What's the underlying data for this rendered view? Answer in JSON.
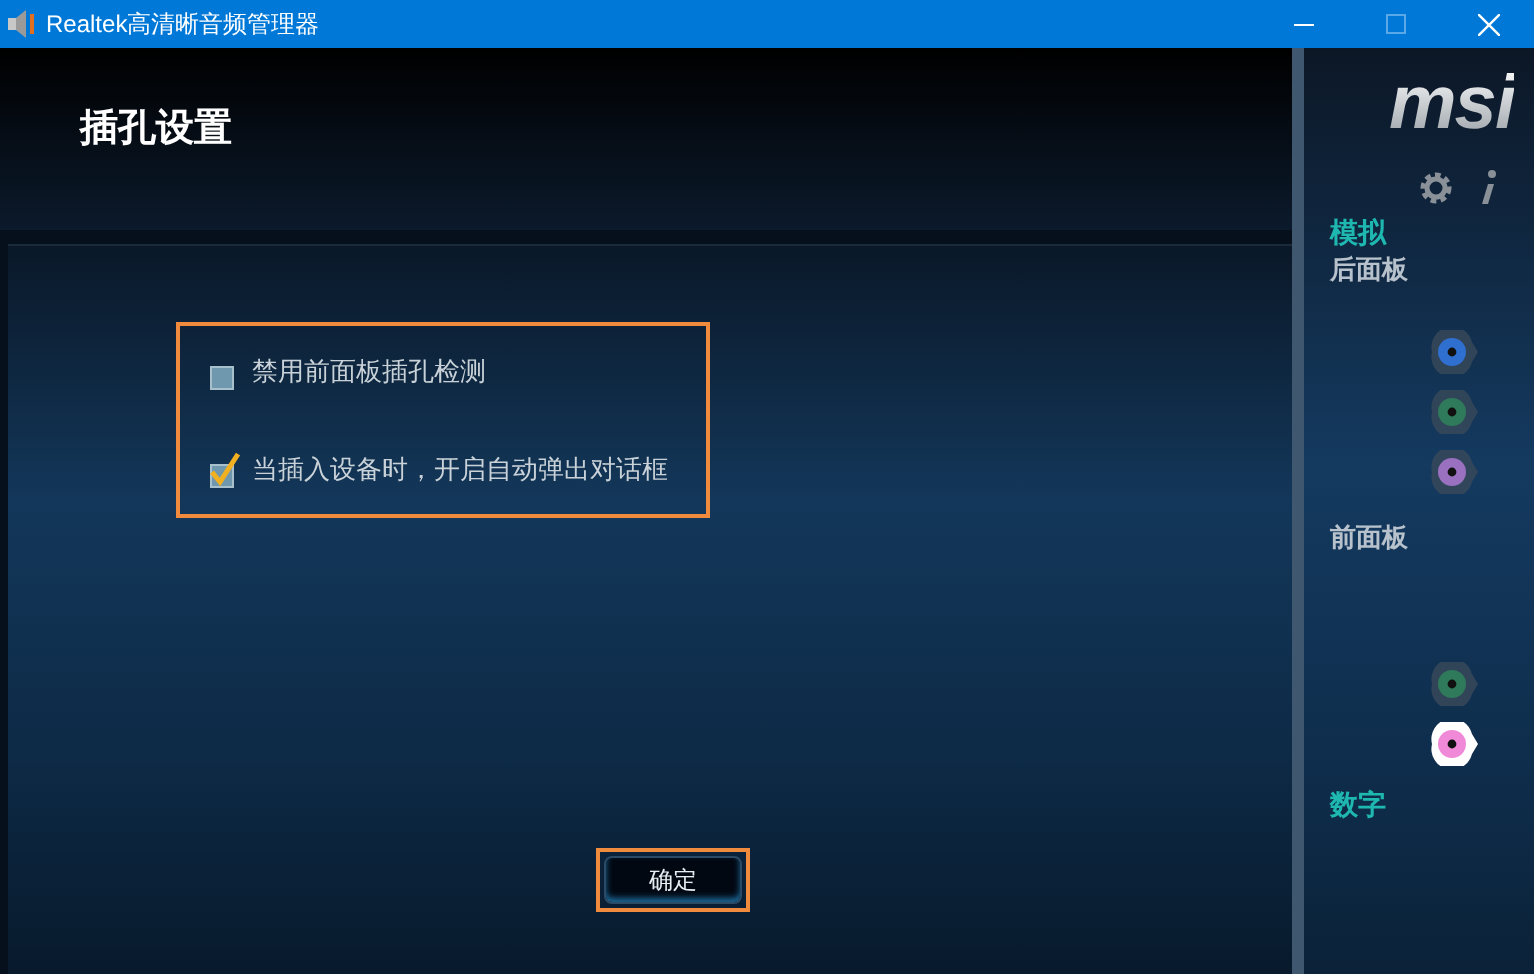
{
  "window": {
    "title": "Realtek高清晰音频管理器"
  },
  "header": {
    "title": "插孔设置"
  },
  "options": [
    {
      "label": "禁用前面板插孔检测",
      "checked": false
    },
    {
      "label": "当插入设备时，开启自动弹出对话框",
      "checked": true
    }
  ],
  "ok_button": "确定",
  "sidebar": {
    "logo": "msi",
    "analog_label": "模拟",
    "sections": [
      {
        "title": "后面板",
        "jacks": [
          {
            "color": "#2f6fd0",
            "active": false
          },
          {
            "color": "#2f7a5a",
            "active": false
          },
          {
            "color": "#9a70c0",
            "active": false
          }
        ]
      },
      {
        "title": "前面板",
        "jacks": [
          {
            "color": "#2f7a5a",
            "active": false
          },
          {
            "color": "#f08ad8",
            "active": true
          }
        ]
      }
    ],
    "digital_label": "数字"
  }
}
